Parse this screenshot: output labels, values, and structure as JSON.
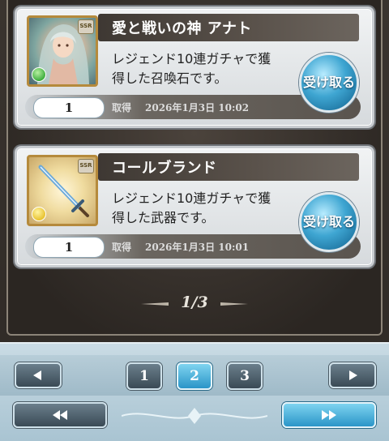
{
  "items": [
    {
      "title": "愛と戦いの神 アナト",
      "description_line1": "レジェンド10連ガチャで獲",
      "description_line2": "得した召喚石です。",
      "count": "1",
      "get_label": "取得",
      "get_time": "2026年1月3日 10:02",
      "receive_label": "受け取る",
      "rarity": "SSR",
      "thumb_icon": "summon-portrait",
      "element_color": "#3fae3f"
    },
    {
      "title": "コールブランド",
      "description_line1": "レジェンド10連ガチャで獲",
      "description_line2": "得した武器です。",
      "count": "1",
      "get_label": "取得",
      "get_time": "2026年1月3日 10:01",
      "receive_label": "受け取る",
      "rarity": "SSR",
      "thumb_icon": "sword-icon",
      "element_color": "#e8c230"
    }
  ],
  "page_indicator": "1/3",
  "pagination": {
    "pages": [
      "1",
      "2",
      "3"
    ],
    "current": "2"
  },
  "colors": {
    "accent_blue": "#2a95c8",
    "panel_dark": "#2b2622"
  }
}
